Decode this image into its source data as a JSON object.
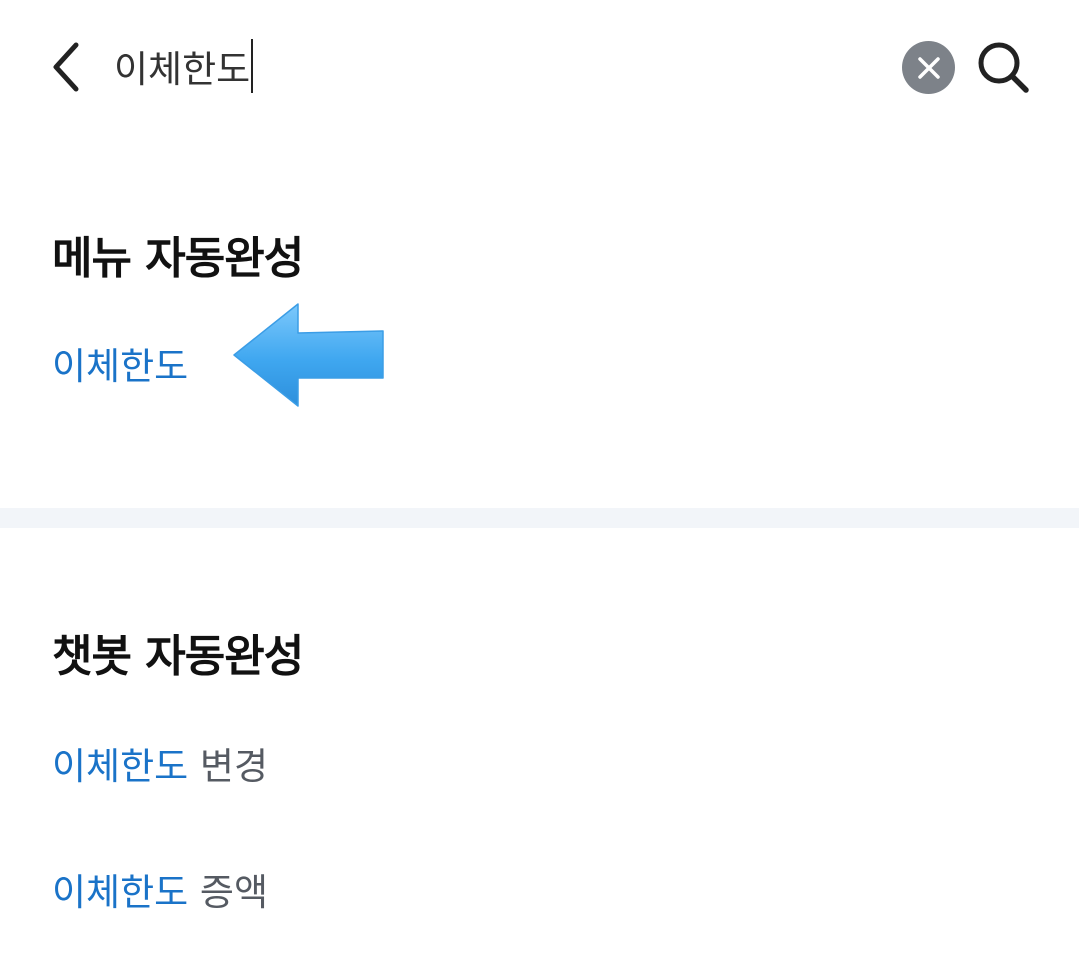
{
  "header": {
    "search_value": "이체한도",
    "back_icon": "chevron-left-icon",
    "clear_icon": "close-circle-icon",
    "search_icon": "search-icon"
  },
  "menu_section": {
    "title": "메뉴 자동완성",
    "items": [
      {
        "highlight": "이체한도",
        "rest": ""
      }
    ]
  },
  "chatbot_section": {
    "title": "챗봇 자동완성",
    "items": [
      {
        "highlight": "이체한도",
        "rest": " 변경"
      },
      {
        "highlight": "이체한도",
        "rest": " 증액"
      }
    ]
  },
  "colors": {
    "highlight": "#1a73c8",
    "clear_button": "#7d8289",
    "divider": "#f2f5f9",
    "arrow": "#3fa7f0"
  }
}
